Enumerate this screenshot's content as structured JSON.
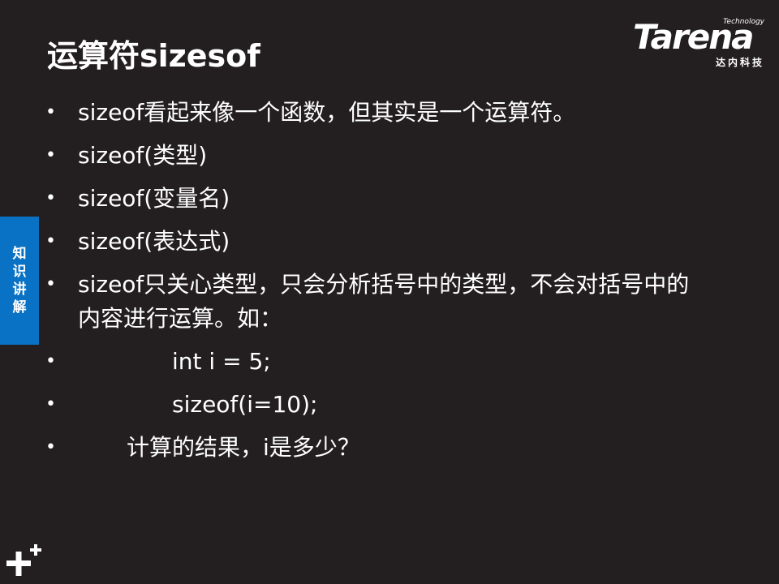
{
  "slide": {
    "title": "运算符sizesof",
    "logo": {
      "technology": "Technology",
      "brand": "Tarena",
      "subtitle": "达内科技"
    },
    "side_tab": [
      "知",
      "识",
      "讲",
      "解"
    ],
    "bullets": [
      "sizeof看起来像一个函数，但其实是一个运算符。",
      "sizeof(类型)",
      "sizeof(变量名)",
      "sizeof(表达式)",
      "sizeof只关心类型，只会分析括号中的类型，不会对括号中的内容进行运算。如：",
      "int i = 5;",
      "sizeof(i=10);",
      "计算的结果，i是多少？"
    ],
    "bullet_symbol": "•",
    "colors": {
      "background": "#231f20",
      "text": "#ffffff",
      "side_tab": "#0a72c4"
    },
    "icons": [
      "plus-decoration-icon"
    ]
  }
}
